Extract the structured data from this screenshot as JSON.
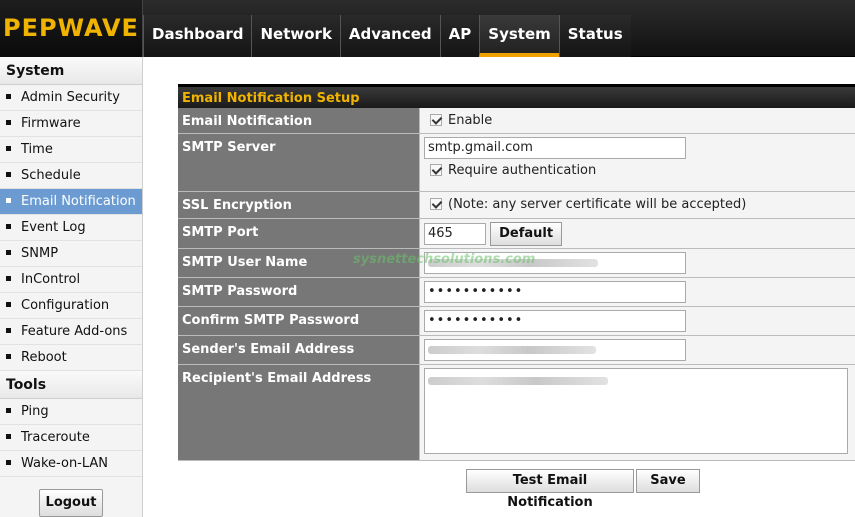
{
  "header": {
    "logo": "PEPWAVE",
    "tabs": [
      {
        "label": "Dashboard"
      },
      {
        "label": "Network"
      },
      {
        "label": "Advanced"
      },
      {
        "label": "AP"
      },
      {
        "label": "System"
      },
      {
        "label": "Status"
      }
    ],
    "active_tab": "System"
  },
  "sidebar": {
    "system_heading": "System",
    "system_items": [
      {
        "label": "Admin Security"
      },
      {
        "label": "Firmware"
      },
      {
        "label": "Time"
      },
      {
        "label": "Schedule"
      },
      {
        "label": "Email Notification"
      },
      {
        "label": "Event Log"
      },
      {
        "label": "SNMP"
      },
      {
        "label": "InControl"
      },
      {
        "label": "Configuration"
      },
      {
        "label": "Feature Add-ons"
      },
      {
        "label": "Reboot"
      }
    ],
    "active_item": "Email Notification",
    "tools_heading": "Tools",
    "tools_items": [
      {
        "label": "Ping"
      },
      {
        "label": "Traceroute"
      },
      {
        "label": "Wake-on-LAN"
      }
    ],
    "logout_label": "Logout"
  },
  "form": {
    "title": "Email Notification Setup",
    "email_notification": {
      "label": "Email Notification",
      "checkbox_label": "Enable",
      "checked": true
    },
    "smtp_server": {
      "label": "SMTP Server",
      "value": "smtp.gmail.com",
      "auth_label": "Require authentication",
      "auth_checked": true
    },
    "ssl": {
      "label": "SSL Encryption",
      "note": "(Note: any server certificate will be accepted)",
      "checked": true
    },
    "smtp_port": {
      "label": "SMTP Port",
      "value": "465",
      "default_label": "Default"
    },
    "smtp_user": {
      "label": "SMTP User Name"
    },
    "smtp_password": {
      "label": "SMTP Password",
      "value": "•••••••••••"
    },
    "confirm_password": {
      "label": "Confirm SMTP Password",
      "value": "•••••••••••"
    },
    "sender": {
      "label": "Sender's Email Address"
    },
    "recipient": {
      "label": "Recipient's Email Address"
    }
  },
  "actions": {
    "test_label": "Test Email Notification",
    "save_label": "Save"
  },
  "watermark": "sysnettechsolutions.com"
}
